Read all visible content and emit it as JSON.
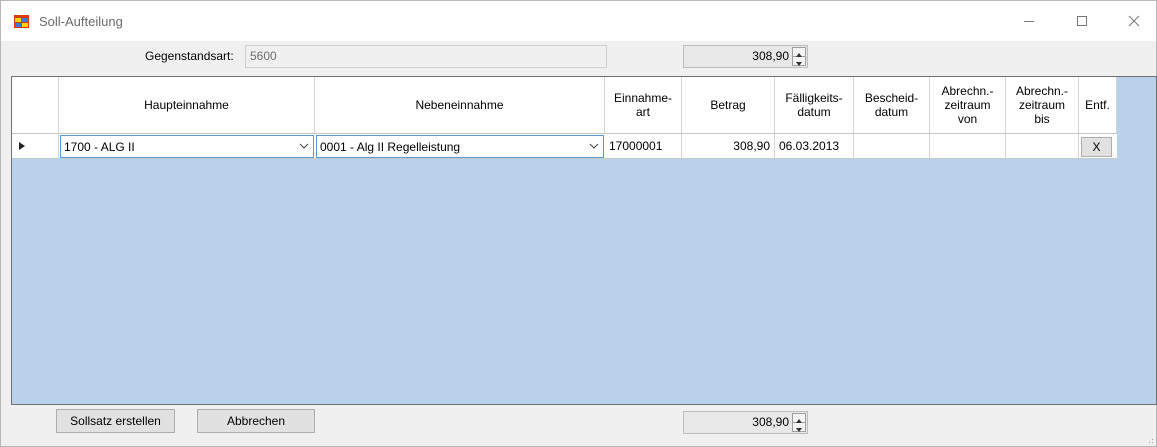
{
  "window": {
    "title": "Soll-Aufteilung",
    "icon": "app-window-icon",
    "controls": [
      "minimize-icon",
      "maximize-icon",
      "close-icon"
    ]
  },
  "top": {
    "gegenstandsart_label": "Gegenstandsart:",
    "gegenstandsart_value": "5600",
    "sum_value": "308,90"
  },
  "grid": {
    "columns": [
      "",
      "Haupteinnahme",
      "Nebeneinnahme",
      "Einnahme-\nart",
      "Betrag",
      "Fälligkeits-\ndatum",
      "Bescheid-\ndatum",
      "Abrechn.-\nzeitraum\nvon",
      "Abrechn.-\nzeitraum\nbis",
      "Entf."
    ],
    "row": {
      "haupteinnahme": "1700 - ALG II",
      "nebeneinnahme": "0001 - Alg II Regelleistung",
      "einnahmeart": "17000001",
      "betrag": "308,90",
      "faelligkeitsdatum": "06.03.2013",
      "bescheiddatum": "",
      "zeitraum_von": "",
      "zeitraum_bis": "",
      "delete_label": "X"
    },
    "background": "#b9d1ea"
  },
  "bottom": {
    "create_label": "Sollsatz erstellen",
    "cancel_label": "Abbrechen",
    "sum_value": "308,90"
  }
}
